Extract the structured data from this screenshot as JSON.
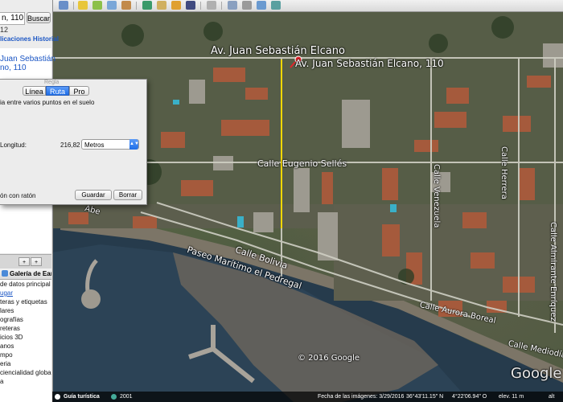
{
  "sidebar": {
    "search_value": "n, 110",
    "search_button": "Buscar",
    "search_sub": "12",
    "tabs": "licaciones  Historial",
    "result_title_line1": "Juan Sebastián",
    "result_title_line2": "no, 110",
    "places_buttons": [
      "+",
      "+"
    ],
    "layers_header": "Galería de Earth",
    "layers": [
      "de datos principal",
      "ugar",
      "teras y etiquetas",
      "lares",
      "ografías",
      "reteras",
      "icios 3D",
      "anos",
      "mpo",
      "eria",
      "ciencialidad global",
      "a"
    ]
  },
  "ruler": {
    "title": "Regla",
    "tabs": [
      "Línea",
      "Ruta",
      "Pro"
    ],
    "active_tab": "Ruta",
    "description": "ia entre varios puntos en el suelo",
    "length_label": "Longitud:",
    "length_value": "216,82",
    "unit": "Metros",
    "mouse_label": "ón con ratón",
    "save_button": "Guardar",
    "clear_button": "Borrar"
  },
  "map": {
    "streets": {
      "elcano": "Av. Juan Sebastián Elcano",
      "placemark": "Av. Juan Sebastián Elcano, 110",
      "selles": "Calle Eugenio Sellés",
      "herrera": "Calle Herrera",
      "venezuela": "Calle Venezuela",
      "bolivia": "Calle Bolivia",
      "paseo": "Paseo Marítimo el Pedregal",
      "almirante": "Calle Almirante Enríquez",
      "aurora": "Calle Aurora Boreal",
      "mediodia": "Calle Mediodía",
      "abe": "Abe"
    },
    "copyright": "© 2016 Google",
    "watermark": "Google"
  },
  "status": {
    "tour_button": "Guía turística",
    "year": "2001",
    "date": "Fecha de las imágenes: 3/29/2016",
    "lat": "36°43'11.15\" N",
    "lon": "4°22'06.94\" O",
    "elev": "elev.  11 m",
    "alt": "alt"
  }
}
